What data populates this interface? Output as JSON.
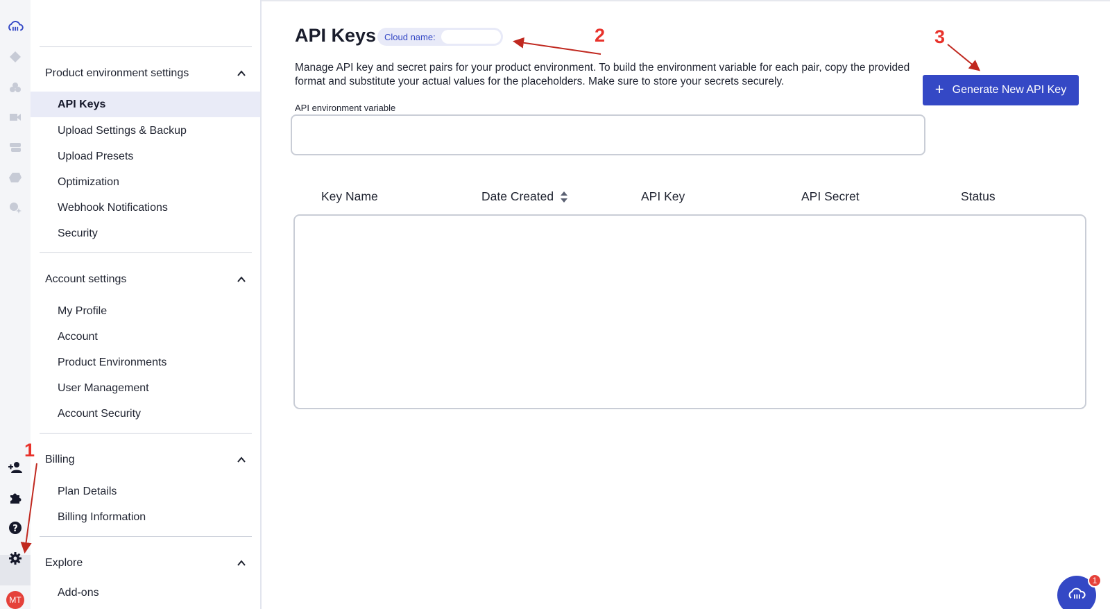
{
  "page": {
    "title": "API Keys",
    "cloud_name_label": "Cloud name:",
    "cloud_name_value": "",
    "description": "Manage API key and secret pairs for your product environment. To build the environment variable for each pair, copy the provided format and substitute your actual values for the placeholders. Make sure to store your secrets securely.",
    "generate_button": "Generate New API Key",
    "env_variable_label": "API environment variable",
    "env_variable_value": ""
  },
  "table": {
    "columns": [
      "Key Name",
      "Date Created",
      "API Key",
      "API Secret",
      "Status"
    ]
  },
  "nav": {
    "sections": [
      {
        "title": "Product environment settings",
        "items": [
          "API Keys",
          "Upload Settings & Backup",
          "Upload Presets",
          "Optimization",
          "Webhook Notifications",
          "Security"
        ]
      },
      {
        "title": "Account settings",
        "items": [
          "My Profile",
          "Account",
          "Product Environments",
          "User Management",
          "Account Security"
        ]
      },
      {
        "title": "Billing",
        "items": [
          "Plan Details",
          "Billing Information"
        ]
      },
      {
        "title": "Explore",
        "items": [
          "Add-ons"
        ]
      }
    ],
    "active_item": "API Keys"
  },
  "rail": {
    "icons": [
      "cloudinary-logo-icon",
      "diamond-icon",
      "assets-icon",
      "video-icon",
      "layers-icon",
      "cube-icon",
      "sparkle-icon",
      "add-user-icon",
      "puzzle-icon",
      "help-icon",
      "settings-icon"
    ],
    "avatar_initials": "MT"
  },
  "annotations": [
    "1",
    "2",
    "3"
  ],
  "chat": {
    "badge_count": "1"
  },
  "colors": {
    "accent": "#3448c5",
    "annotation": "#e8322b",
    "avatar": "#e5413a"
  }
}
